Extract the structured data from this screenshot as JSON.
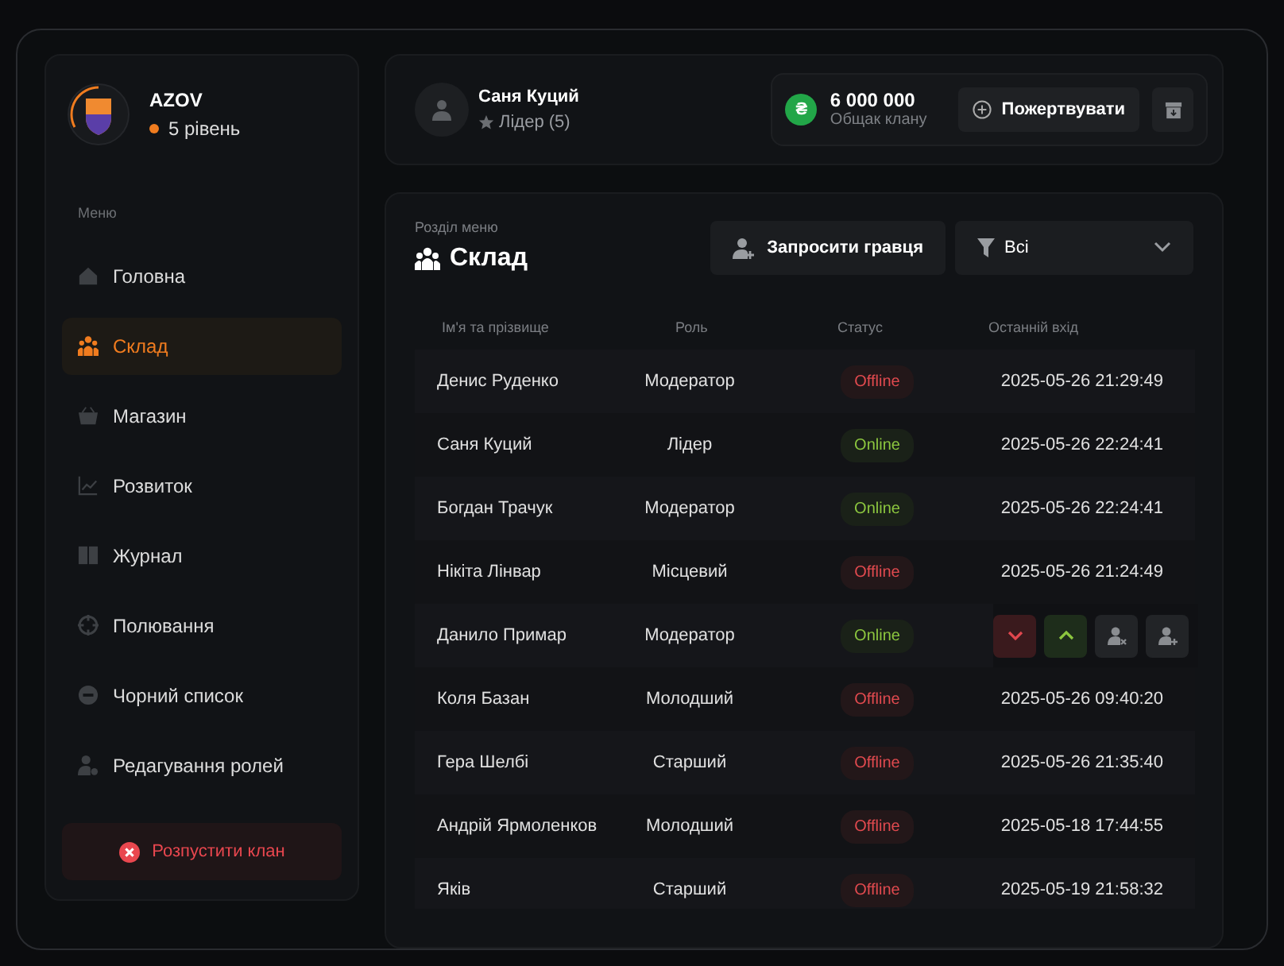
{
  "clan": {
    "name": "AZOV",
    "level": "5 рівень"
  },
  "menu": {
    "heading": "Меню",
    "items": [
      {
        "label": "Головна",
        "selected": false
      },
      {
        "label": "Склад",
        "selected": true
      },
      {
        "label": "Магазин",
        "selected": false
      },
      {
        "label": "Розвиток",
        "selected": false
      },
      {
        "label": "Журнал",
        "selected": false
      },
      {
        "label": "Полювання",
        "selected": false
      },
      {
        "label": "Чорний список",
        "selected": false
      },
      {
        "label": "Редагування ролей",
        "selected": false
      }
    ]
  },
  "disband_button": "Розпустити клан",
  "player": {
    "name": "Саня Куций",
    "rank": "Лідер (5)"
  },
  "bank": {
    "currency_symbol": "₴",
    "amount": "6 000 000",
    "label": "Общак клану",
    "donate_button": "Пожертвувати"
  },
  "section": {
    "caption": "Розділ меню",
    "title": "Склад",
    "invite_button": "Запросити гравця",
    "filter": {
      "value": "Всі"
    }
  },
  "table": {
    "columns": [
      "Ім'я та прізвище",
      "Роль",
      "Статус",
      "Останній вхід"
    ],
    "rows": [
      {
        "name": "Денис Руденко",
        "role": "Модератор",
        "status": "Offline",
        "online": false,
        "hovered": false,
        "last_login": "2025-05-26 21:29:49"
      },
      {
        "name": "Саня Куций",
        "role": "Лідер",
        "status": "Online",
        "online": true,
        "hovered": false,
        "last_login": "2025-05-26 22:24:41"
      },
      {
        "name": "Богдан Трачук",
        "role": "Модератор",
        "status": "Online",
        "online": true,
        "hovered": false,
        "last_login": "2025-05-26 22:24:41"
      },
      {
        "name": "Нікіта Лінвар",
        "role": "Місцевий",
        "status": "Offline",
        "online": false,
        "hovered": false,
        "last_login": "2025-05-26 21:24:49"
      },
      {
        "name": "Данило Примар",
        "role": "Модератор",
        "status": "Online",
        "online": true,
        "hovered": true
      },
      {
        "name": "Коля Базан",
        "role": "Молодший",
        "status": "Offline",
        "online": false,
        "hovered": false,
        "last_login": "2025-05-26 09:40:20"
      },
      {
        "name": "Гера Шелбі",
        "role": "Старший",
        "status": "Offline",
        "online": false,
        "hovered": false,
        "last_login": "2025-05-26 21:35:40"
      },
      {
        "name": "Андрій Ярмоленков",
        "role": "Молодший",
        "status": "Offline",
        "online": false,
        "hovered": false,
        "last_login": "2025-05-18 17:44:55"
      },
      {
        "name": "Яків",
        "role": "Старший",
        "status": "Offline",
        "online": false,
        "hovered": false,
        "last_login": "2025-05-19 21:58:32"
      }
    ]
  }
}
